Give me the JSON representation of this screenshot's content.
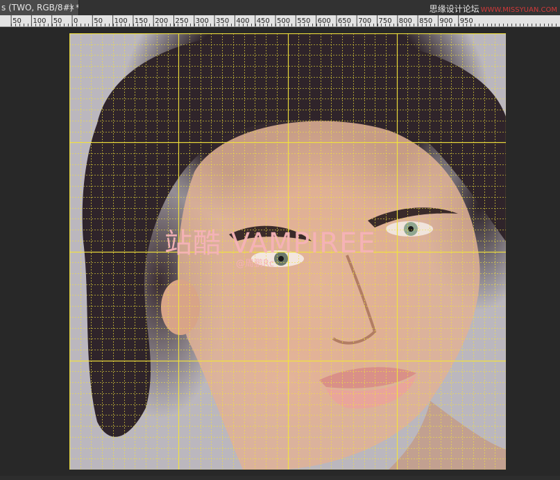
{
  "tab": {
    "title": "s (TWO, RGB/8#) *",
    "close_glyph": "×"
  },
  "site_watermark": {
    "chinese": "思缘设计论坛",
    "english": "WWW.MISSYUAN.COM"
  },
  "ruler": {
    "left_labels": [
      "50",
      "100",
      "50"
    ],
    "labels": [
      "0",
      "50",
      "100",
      "150",
      "200",
      "250",
      "300",
      "350",
      "400",
      "450",
      "500",
      "550",
      "600",
      "650",
      "700",
      "750",
      "800",
      "850",
      "900",
      "950"
    ]
  },
  "canvas": {
    "overlay_title": "站酷 VAMPIREE",
    "overlay_author": "@周鹏Rc",
    "grid_color": "#f2e33c",
    "background_color": "#bbb7be"
  }
}
